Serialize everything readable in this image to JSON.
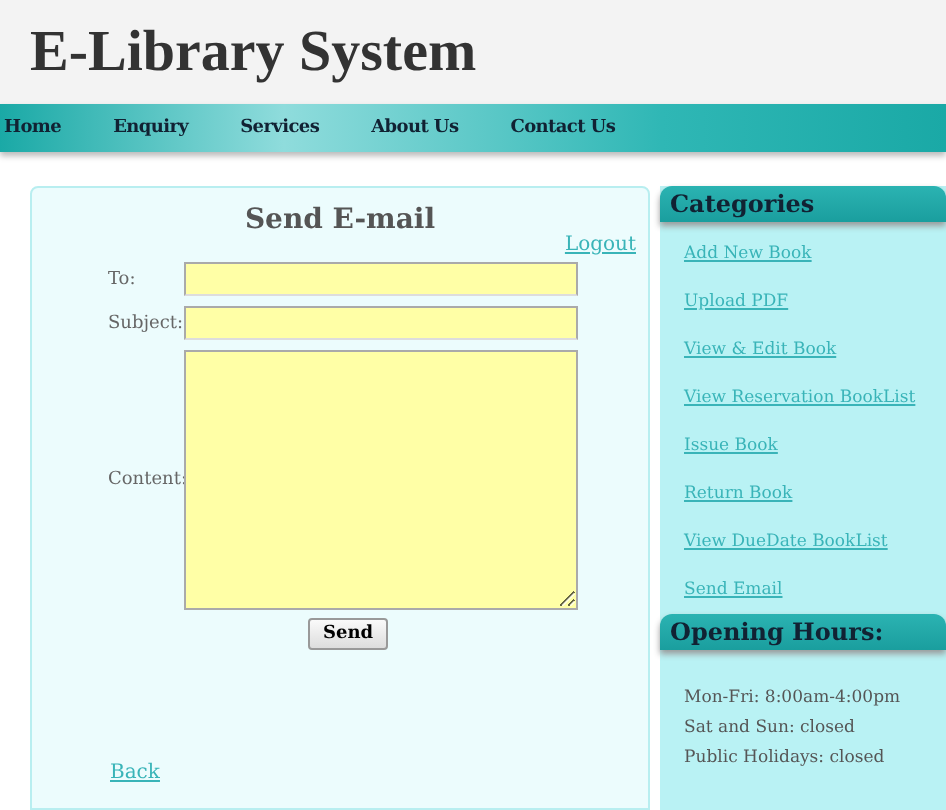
{
  "site_title": "E-Library System",
  "nav": [
    "Home",
    "Enquiry",
    "Services",
    "About Us",
    "Contact Us"
  ],
  "form": {
    "title": "Send E-mail",
    "logout": "Logout",
    "fields": [
      {
        "label": "To:",
        "kind": "input"
      },
      {
        "label": "Subject:",
        "kind": "input"
      },
      {
        "label": "Content:",
        "kind": "textarea"
      }
    ],
    "submit": "Send",
    "back": "Back"
  },
  "categories": {
    "title": "Categories",
    "links": [
      "Add New Book",
      "Upload PDF",
      "View & Edit Book",
      "View Reservation BookList",
      "Issue Book",
      "Return Book",
      "View DueDate BookList",
      "Send Email"
    ]
  },
  "opening_hours": {
    "title": "Opening Hours:",
    "lines": [
      "Mon-Fri: 8:00am-4:00pm",
      "Sat and Sun: closed",
      "Public Holidays: closed"
    ]
  }
}
